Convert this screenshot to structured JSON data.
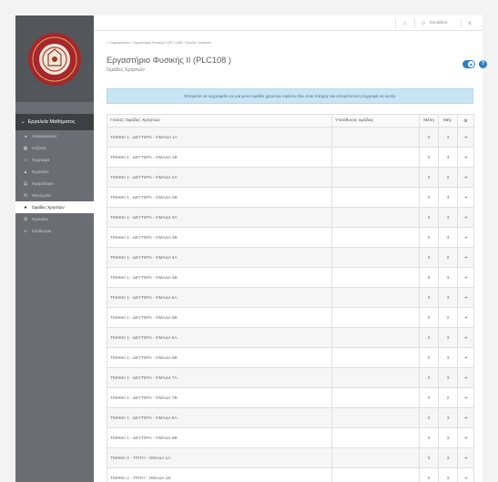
{
  "topbar": {
    "home_icon": "home-icon",
    "user_icon": "user-icon",
    "username": "kondrilos",
    "settings_icon": "sliders-icon"
  },
  "sidebar": {
    "menu_header": "Εργαλεία Μαθήματος",
    "items": [
      {
        "label": "Ανακοινώσεις",
        "icon": "megaphone-icon",
        "active": false
      },
      {
        "label": "Ατζέντα",
        "icon": "calendar-icon",
        "active": false
      },
      {
        "label": "Έγγραφα",
        "icon": "folder-icon",
        "active": false
      },
      {
        "label": "Εργασίες",
        "icon": "flask-icon",
        "active": false
      },
      {
        "label": "Ημερολόγιο",
        "icon": "calendar-icon",
        "active": false
      },
      {
        "label": "Μηνύματα",
        "icon": "envelope-icon",
        "active": false
      },
      {
        "label": "Ομάδες Χρηστών",
        "icon": "users-icon",
        "active": true
      },
      {
        "label": "Πρόοδος",
        "icon": "table-icon",
        "active": false
      },
      {
        "label": "Σύνδεσμοι",
        "icon": "link-icon",
        "active": false
      }
    ]
  },
  "breadcrumb": {
    "home": "Χαρτοφυλάκιο",
    "course": "Εργαστήριο Φυσικής ΙΙ (PLC108)",
    "current": "Ομάδες Χρηστών"
  },
  "page": {
    "title": "Εργαστήριο Φυσικής ΙΙ (PLC108 )",
    "subtitle": "Ομάδες Χρηστών"
  },
  "alert": {
    "text": "Μπορείτε να εγγραφείτε σε μια μόνο ομάδα χρηστών εφόσον δεν είναι πλήρης και επιτρέπεται η εγγραφή σε αυτήν"
  },
  "table": {
    "headers": {
      "name": "Γενικές Ομάδες Χρηστών",
      "responsible": "Υπεύθυνος ομάδας",
      "members": "Μέλη",
      "max": "Μέγ."
    },
    "action_icon": "sign-in-icon",
    "header_action_icon": "gears-icon",
    "rows": [
      {
        "name": "ΤΜΗΜΑ 1 - ΔΕΥΤΕΡΑ - ΟΜΑΔΑ 1Α",
        "responsible": "",
        "members": "0",
        "max": "3"
      },
      {
        "name": "ΤΜΗΜΑ 1 - ΔΕΥΤΕΡΑ - ΟΜΑΔΑ 1Β",
        "responsible": "",
        "members": "0",
        "max": "3"
      },
      {
        "name": "ΤΜΗΜΑ 1 - ΔΕΥΤΕΡΑ - ΟΜΑΔΑ 2Α",
        "responsible": "",
        "members": "0",
        "max": "2"
      },
      {
        "name": "ΤΜΗΜΑ 1 - ΔΕΥΤΕΡΑ - ΟΜΑΔΑ 2Β",
        "responsible": "",
        "members": "0",
        "max": "3"
      },
      {
        "name": "ΤΜΗΜΑ 1 - ΔΕΥΤΕΡΑ - ΟΜΑΔΑ 3Α",
        "responsible": "",
        "members": "0",
        "max": "3"
      },
      {
        "name": "ΤΜΗΜΑ 1 - ΔΕΥΤΕΡΑ - ΟΜΑΔΑ 3Β",
        "responsible": "",
        "members": "0",
        "max": "3"
      },
      {
        "name": "ΤΜΗΜΑ 1 - ΔΕΥΤΕΡΑ - ΟΜΑΔΑ 4Α",
        "responsible": "",
        "members": "0",
        "max": "2"
      },
      {
        "name": "ΤΜΗΜΑ 1 - ΔΕΥΤΕΡΑ - ΟΜΑΔΑ 4Β",
        "responsible": "",
        "members": "0",
        "max": "3"
      },
      {
        "name": "ΤΜΗΜΑ 1 - ΔΕΥΤΕΡΑ - ΟΜΑΔΑ 5Α",
        "responsible": "",
        "members": "0",
        "max": "3"
      },
      {
        "name": "ΤΜΗΜΑ 1 - ΔΕΥΤΕΡΑ - ΟΜΑΔΑ 5Β",
        "responsible": "",
        "members": "0",
        "max": "2"
      },
      {
        "name": "ΤΜΗΜΑ 1 - ΔΕΥΤΕΡΑ - ΟΜΑΔΑ 6Α",
        "responsible": "",
        "members": "0",
        "max": "3"
      },
      {
        "name": "ΤΜΗΜΑ 1 - ΔΕΥΤΕΡΑ - ΟΜΑΔΑ 6Β",
        "responsible": "",
        "members": "0",
        "max": "3"
      },
      {
        "name": "ΤΜΗΜΑ 1 - ΔΕΥΤΕΡΑ - ΟΜΑΔΑ 7Α",
        "responsible": "",
        "members": "0",
        "max": "3"
      },
      {
        "name": "ΤΜΗΜΑ 1 - ΔΕΥΤΕΡΑ - ΟΜΑΔΑ 7Β",
        "responsible": "",
        "members": "0",
        "max": "2"
      },
      {
        "name": "ΤΜΗΜΑ 1 - ΔΕΥΤΕΡΑ - ΟΜΑΔΑ 8Α",
        "responsible": "",
        "members": "0",
        "max": "3"
      },
      {
        "name": "ΤΜΗΜΑ 1 - ΔΕΥΤΕΡΑ - ΟΜΑΔΑ 8Β",
        "responsible": "",
        "members": "0",
        "max": "3"
      },
      {
        "name": "ΤΜΗΜΑ 2 - ΤΡΙΤΗ - ΟΜΑΔΑ 1Α",
        "responsible": "",
        "members": "0",
        "max": "3"
      },
      {
        "name": "ΤΜΗΜΑ 2 - ΤΡΙΤΗ - ΟΜΑΔΑ 1Β",
        "responsible": "",
        "members": "0",
        "max": "3"
      }
    ]
  },
  "colors": {
    "sidebar": "#6a6d73",
    "accent": "#2e7fc4",
    "alert_bg": "#c9e5f3",
    "logo_red": "#a8262c"
  }
}
